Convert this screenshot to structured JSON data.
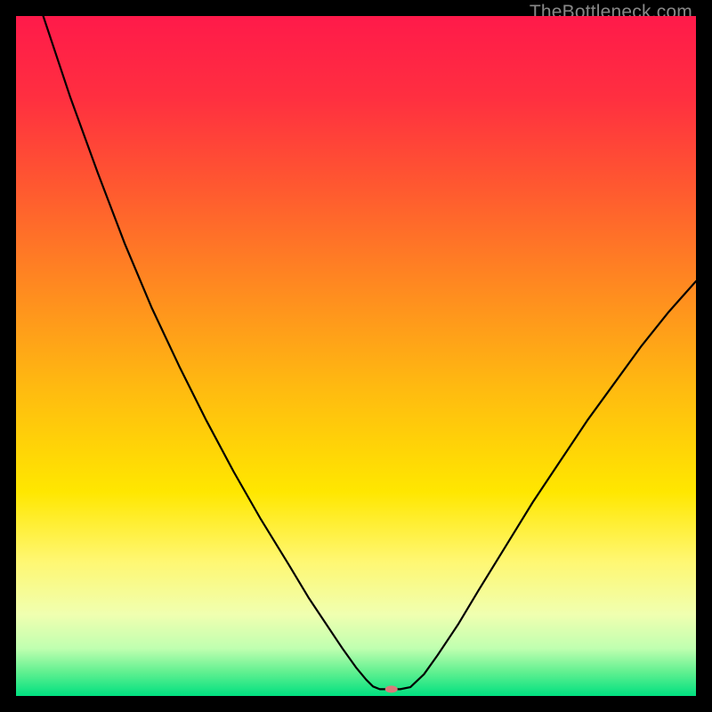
{
  "watermark": "TheBottleneck.com",
  "chart_data": {
    "type": "line",
    "title": "",
    "xlabel": "",
    "ylabel": "",
    "xlim": [
      0,
      100
    ],
    "ylim": [
      0,
      100
    ],
    "background_gradient": {
      "stops": [
        {
          "offset": 0.0,
          "color": "#ff1a4a"
        },
        {
          "offset": 0.12,
          "color": "#ff2f40"
        },
        {
          "offset": 0.25,
          "color": "#ff5830"
        },
        {
          "offset": 0.4,
          "color": "#ff8a20"
        },
        {
          "offset": 0.55,
          "color": "#ffbb10"
        },
        {
          "offset": 0.7,
          "color": "#ffe700"
        },
        {
          "offset": 0.8,
          "color": "#fff770"
        },
        {
          "offset": 0.88,
          "color": "#f0ffb0"
        },
        {
          "offset": 0.93,
          "color": "#c0ffb0"
        },
        {
          "offset": 0.965,
          "color": "#60f090"
        },
        {
          "offset": 1.0,
          "color": "#00e080"
        }
      ]
    },
    "series": [
      {
        "name": "bottleneck-curve",
        "color": "#000000",
        "width": 2.2,
        "points": [
          {
            "x": 4.0,
            "y": 100.0
          },
          {
            "x": 8.0,
            "y": 88.0
          },
          {
            "x": 12.0,
            "y": 77.0
          },
          {
            "x": 16.0,
            "y": 66.5
          },
          {
            "x": 20.0,
            "y": 57.0
          },
          {
            "x": 24.0,
            "y": 48.5
          },
          {
            "x": 28.0,
            "y": 40.5
          },
          {
            "x": 32.0,
            "y": 33.0
          },
          {
            "x": 36.0,
            "y": 26.0
          },
          {
            "x": 40.0,
            "y": 19.5
          },
          {
            "x": 43.0,
            "y": 14.5
          },
          {
            "x": 46.0,
            "y": 10.0
          },
          {
            "x": 48.0,
            "y": 7.0
          },
          {
            "x": 50.0,
            "y": 4.2
          },
          {
            "x": 51.5,
            "y": 2.4
          },
          {
            "x": 52.5,
            "y": 1.4
          },
          {
            "x": 53.5,
            "y": 1.0
          },
          {
            "x": 55.0,
            "y": 1.0
          },
          {
            "x": 56.5,
            "y": 1.0
          },
          {
            "x": 58.0,
            "y": 1.3
          },
          {
            "x": 60.0,
            "y": 3.2
          },
          {
            "x": 62.0,
            "y": 6.0
          },
          {
            "x": 65.0,
            "y": 10.5
          },
          {
            "x": 68.0,
            "y": 15.5
          },
          {
            "x": 72.0,
            "y": 22.0
          },
          {
            "x": 76.0,
            "y": 28.5
          },
          {
            "x": 80.0,
            "y": 34.5
          },
          {
            "x": 84.0,
            "y": 40.5
          },
          {
            "x": 88.0,
            "y": 46.0
          },
          {
            "x": 92.0,
            "y": 51.5
          },
          {
            "x": 96.0,
            "y": 56.5
          },
          {
            "x": 100.0,
            "y": 61.0
          }
        ]
      }
    ],
    "marker": {
      "x": 55.2,
      "y": 1.0,
      "color": "#d97a7a",
      "rx": 7,
      "ry": 4
    }
  }
}
